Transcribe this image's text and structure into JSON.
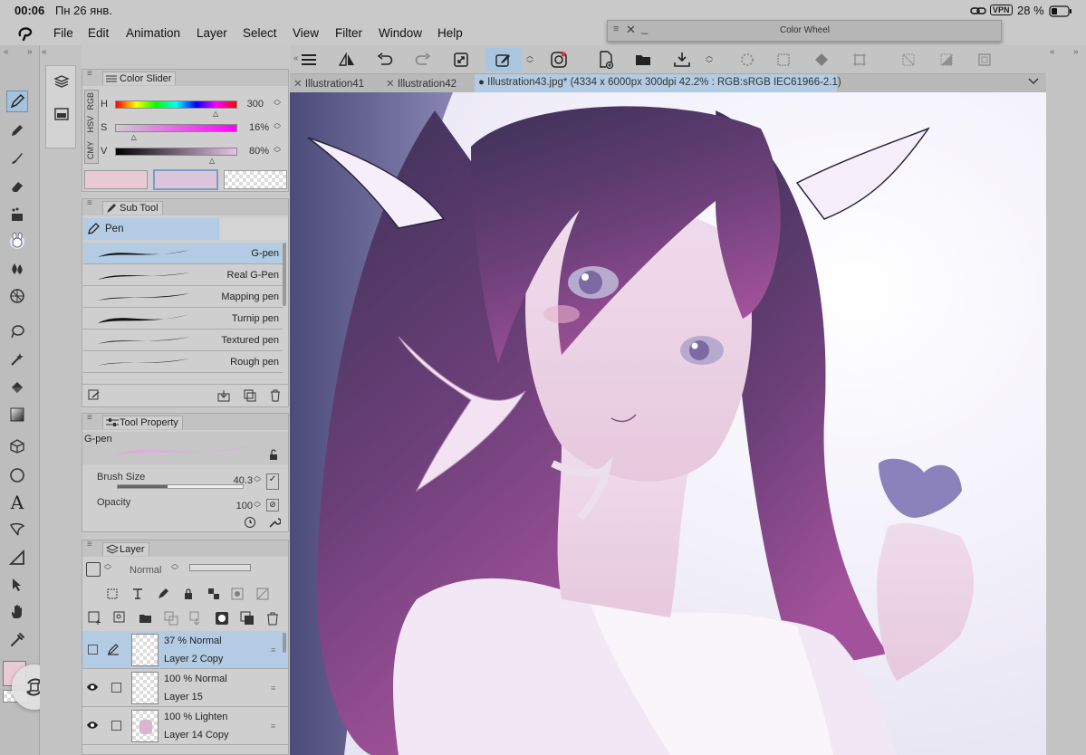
{
  "status": {
    "time": "00:06",
    "date": "Пн 26 янв.",
    "vpn": "VPN",
    "battery": "28 %"
  },
  "menu": [
    "File",
    "Edit",
    "Animation",
    "Layer",
    "Select",
    "View",
    "Filter",
    "Window",
    "Help"
  ],
  "color_wheel": {
    "title": "Color Wheel"
  },
  "tabs": [
    {
      "label": "Illustration41"
    },
    {
      "label": "Illustration42"
    },
    {
      "label": "Illustration43.jpg* (4334 x 6000px 300dpi 42.2% : RGB:sRGB IEC61966-2.1)"
    }
  ],
  "color_slider": {
    "title": "Color Slider",
    "mode_labels": [
      "RGB",
      "HSV",
      "CMY"
    ],
    "h": {
      "label": "H",
      "value": "300",
      "fraction": 0.83
    },
    "s": {
      "label": "S",
      "value": "16%",
      "fraction": 0.16
    },
    "v": {
      "label": "V",
      "value": "80%",
      "fraction": 0.8
    },
    "main_color": "#e8c9d4",
    "sub_color": "#dbc4dc"
  },
  "sub_tool": {
    "title": "Sub Tool",
    "group": "Pen",
    "items": [
      "G-pen",
      "Real G-Pen",
      "Mapping pen",
      "Turnip pen",
      "Textured pen",
      "Rough pen"
    ]
  },
  "tool_property": {
    "title": "Tool Property",
    "tool_name": "G-pen",
    "brush_size_label": "Brush Size",
    "brush_size": "40.3",
    "brush_size_fraction": 0.4,
    "opacity_label": "Opacity",
    "opacity": "100"
  },
  "layer_panel": {
    "title": "Layer",
    "blend_mode": "Normal",
    "layers": [
      {
        "mode": "37 %  Normal",
        "name": "Layer 2 Copy",
        "selected": true
      },
      {
        "mode": "100 %  Normal",
        "name": "Layer 15",
        "selected": false
      },
      {
        "mode": "100 %  Lighten",
        "name": "Layer 14 Copy",
        "selected": false
      }
    ]
  },
  "colors": {
    "accent": "#a9c6e0",
    "selection": "#b3cbe3"
  }
}
